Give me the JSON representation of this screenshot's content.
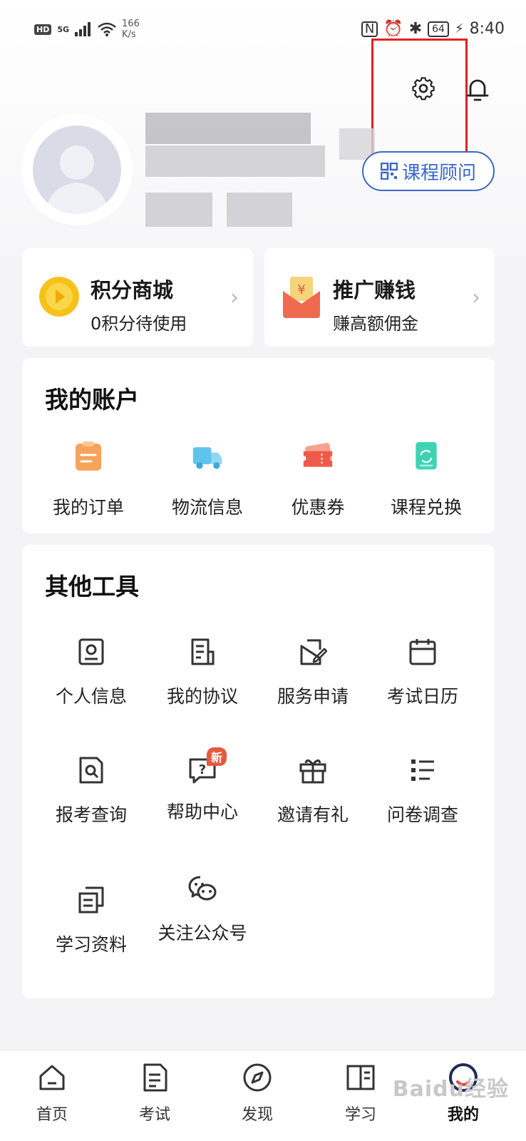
{
  "status_bar": {
    "hd": "HD",
    "signal": "5G",
    "speed_value": "166",
    "speed_unit": "K/s",
    "battery": "64",
    "time": "8:40"
  },
  "header": {
    "advisor_button": "课程顾问"
  },
  "promos": [
    {
      "title": "积分商城",
      "subtitle": "0积分待使用"
    },
    {
      "title": "推广赚钱",
      "subtitle": "赚高额佣金"
    }
  ],
  "account": {
    "title": "我的账户",
    "items": [
      {
        "label": "我的订单",
        "icon": "order-icon"
      },
      {
        "label": "物流信息",
        "icon": "truck-icon"
      },
      {
        "label": "优惠券",
        "icon": "coupon-icon"
      },
      {
        "label": "课程兑换",
        "icon": "exchange-icon"
      }
    ]
  },
  "tools": {
    "title": "其他工具",
    "new_badge": "新",
    "items": [
      {
        "label": "个人信息",
        "icon": "profile-card-icon"
      },
      {
        "label": "我的协议",
        "icon": "document-icon"
      },
      {
        "label": "服务申请",
        "icon": "edit-icon"
      },
      {
        "label": "考试日历",
        "icon": "calendar-icon"
      },
      {
        "label": "报考查询",
        "icon": "search-doc-icon"
      },
      {
        "label": "帮助中心",
        "icon": "help-icon"
      },
      {
        "label": "邀请有礼",
        "icon": "gift-icon"
      },
      {
        "label": "问卷调查",
        "icon": "list-icon"
      },
      {
        "label": "学习资料",
        "icon": "files-icon"
      },
      {
        "label": "关注公众号",
        "icon": "wechat-icon"
      }
    ]
  },
  "nav": [
    {
      "label": "首页",
      "icon": "home-icon"
    },
    {
      "label": "考试",
      "icon": "exam-icon"
    },
    {
      "label": "发现",
      "icon": "compass-icon"
    },
    {
      "label": "学习",
      "icon": "book-icon"
    },
    {
      "label": "我的",
      "icon": "profile-icon"
    }
  ],
  "watermark": "Baidu经验"
}
